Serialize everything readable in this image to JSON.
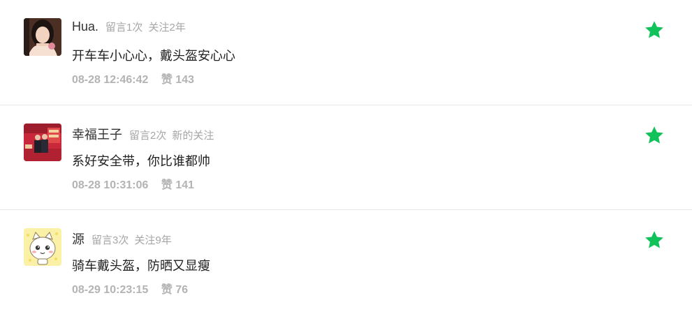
{
  "comments": [
    {
      "nickname": "Hua.",
      "comment_count": "留言1次",
      "follow_info": "关注2年",
      "text": "开车车小心心，戴头盔安心心",
      "time": "08-28 12:46:42",
      "likes": "赞 143",
      "star_color": "#11c25a"
    },
    {
      "nickname": "幸福王子",
      "comment_count": "留言2次",
      "follow_info": "新的关注",
      "text": "系好安全带，你比谁都帅",
      "time": "08-28 10:31:06",
      "likes": "赞 141",
      "star_color": "#11c25a"
    },
    {
      "nickname": "源",
      "comment_count": "留言3次",
      "follow_info": "关注9年",
      "text": "骑车戴头盔，防晒又显瘦",
      "time": "08-29 10:23:15",
      "likes": "赞 76",
      "star_color": "#11c25a"
    }
  ]
}
